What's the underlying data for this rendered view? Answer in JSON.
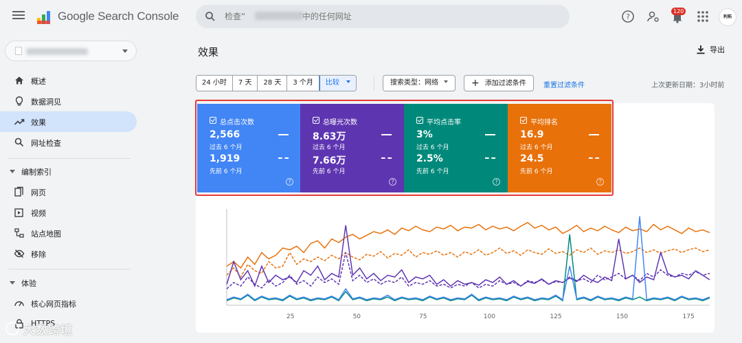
{
  "app": {
    "title": "Google Search Console",
    "notification_count": "120",
    "avatar_text": "利拓"
  },
  "search": {
    "placeholder": "检查“                    ”中的任何网址"
  },
  "sidebar": {
    "items": [
      {
        "label": "概述",
        "icon": "home-icon"
      },
      {
        "label": "数据洞见",
        "icon": "lightbulb-icon"
      },
      {
        "label": "效果",
        "icon": "trending-up-icon",
        "active": true
      },
      {
        "label": "网址检查",
        "icon": "search-icon"
      }
    ],
    "sections": [
      {
        "label": "编制索引",
        "items": [
          {
            "label": "网页",
            "icon": "pages-icon"
          },
          {
            "label": "视频",
            "icon": "video-icon"
          },
          {
            "label": "站点地图",
            "icon": "sitemap-icon"
          },
          {
            "label": "移除",
            "icon": "eye-off-icon"
          }
        ]
      },
      {
        "label": "体验",
        "items": [
          {
            "label": "核心网页指标",
            "icon": "speed-icon"
          },
          {
            "label": "HTTPS",
            "icon": "lock-icon"
          }
        ]
      }
    ]
  },
  "main": {
    "title": "效果",
    "export_label": "导出",
    "date_ranges": [
      "24 小时",
      "7 天",
      "28 天",
      "3 个月",
      "比较"
    ],
    "search_type_label": "搜索类型：网络",
    "add_filter_label": "添加过滤条件",
    "reset_filters_label": "重置过滤条件",
    "last_update": "上次更新日期：3小时前"
  },
  "metrics": [
    {
      "title": "总点击次数",
      "current": "2,566",
      "current_period": "过去 6 个月",
      "previous": "1,919",
      "previous_period": "先前 6 个月",
      "color": "#4285f4"
    },
    {
      "title": "总曝光次数",
      "current": "8.63万",
      "current_period": "过去 6 个月",
      "previous": "7.66万",
      "previous_period": "先前 6 个月",
      "color": "#5e35b1"
    },
    {
      "title": "平均点击率",
      "current": "3%",
      "current_period": "过去 6 个月",
      "previous": "2.5%",
      "previous_period": "先前 6 个月",
      "color": "#00897b"
    },
    {
      "title": "平均排名",
      "current": "16.9",
      "current_period": "过去 6 个月",
      "previous": "24.5",
      "previous_period": "先前 6 个月",
      "color": "#e8710a"
    }
  ],
  "chart_data": {
    "type": "line",
    "x_ticks": [
      "25",
      "50",
      "75",
      "100",
      "125",
      "150",
      "175"
    ],
    "xlim": [
      1,
      183
    ],
    "ylim": [
      0,
      1
    ],
    "grid": false,
    "series": [
      {
        "color": "#e8710a",
        "style": "solid",
        "values": [
          0.4,
          0.45,
          0.38,
          0.5,
          0.42,
          0.55,
          0.48,
          0.52,
          0.6,
          0.58,
          0.62,
          0.55,
          0.65,
          0.68,
          0.6,
          0.7,
          0.66,
          0.72,
          0.75,
          0.7,
          0.74,
          0.78,
          0.76,
          0.8,
          0.75,
          0.82,
          0.79,
          0.84,
          0.8,
          0.78,
          0.83,
          0.81,
          0.85,
          0.79,
          0.83,
          0.82,
          0.86,
          0.8,
          0.84,
          0.81,
          0.83,
          0.79,
          0.84,
          0.88,
          0.82,
          0.85,
          0.8,
          0.83,
          0.76,
          0.8,
          0.85,
          0.78,
          0.82,
          0.79,
          0.84,
          0.8,
          0.77,
          0.83,
          0.79,
          0.81,
          0.78,
          0.86,
          0.8,
          0.84,
          0.8,
          0.76,
          0.82,
          0.78,
          0.8,
          0.77
        ]
      },
      {
        "color": "#e8710a",
        "style": "dashed",
        "values": [
          0.3,
          0.38,
          0.28,
          0.42,
          0.35,
          0.32,
          0.45,
          0.38,
          0.4,
          0.55,
          0.42,
          0.48,
          0.45,
          0.5,
          0.46,
          0.52,
          0.48,
          0.55,
          0.5,
          0.47,
          0.53,
          0.51,
          0.56,
          0.49,
          0.54,
          0.52,
          0.58,
          0.5,
          0.55,
          0.53,
          0.57,
          0.52,
          0.55,
          0.5,
          0.56,
          0.53,
          0.58,
          0.52,
          0.55,
          0.6,
          0.54,
          0.57,
          0.52,
          0.58,
          0.55,
          0.53,
          0.59,
          0.54,
          0.56,
          0.52,
          0.58,
          0.55,
          0.6,
          0.53,
          0.57,
          0.55,
          0.58,
          0.54,
          0.56,
          0.6,
          0.55,
          0.58,
          0.54,
          0.57,
          0.59,
          0.55,
          0.58,
          0.6,
          0.56,
          0.58
        ]
      },
      {
        "color": "#5e35b1",
        "style": "solid",
        "values": [
          0.2,
          0.45,
          0.25,
          0.35,
          0.18,
          0.4,
          0.22,
          0.3,
          0.25,
          0.28,
          0.22,
          0.35,
          0.3,
          0.4,
          0.25,
          0.32,
          0.28,
          0.85,
          0.3,
          0.38,
          0.26,
          0.32,
          0.24,
          0.3,
          0.28,
          0.36,
          0.22,
          0.28,
          0.26,
          0.3,
          0.2,
          0.25,
          0.18,
          0.24,
          0.2,
          0.22,
          0.19,
          0.25,
          0.22,
          0.28,
          0.2,
          0.24,
          0.18,
          0.23,
          0.21,
          0.26,
          0.2,
          0.24,
          0.22,
          0.27,
          0.23,
          0.3,
          0.25,
          0.22,
          0.28,
          0.24,
          0.7,
          0.26,
          0.3,
          0.22,
          0.28,
          0.25,
          0.55,
          0.32,
          0.28,
          0.3,
          0.26,
          0.35,
          0.3,
          0.25
        ]
      },
      {
        "color": "#5e35b1",
        "style": "dashed",
        "values": [
          0.15,
          0.22,
          0.18,
          0.28,
          0.2,
          0.16,
          0.25,
          0.18,
          0.22,
          0.3,
          0.2,
          0.24,
          0.18,
          0.28,
          0.22,
          0.26,
          0.2,
          0.55,
          0.24,
          0.3,
          0.22,
          0.26,
          0.2,
          0.24,
          0.22,
          0.28,
          0.18,
          0.22,
          0.2,
          0.24,
          0.18,
          0.2,
          0.16,
          0.2,
          0.18,
          0.22,
          0.16,
          0.2,
          0.18,
          0.24,
          0.2,
          0.22,
          0.18,
          0.24,
          0.22,
          0.25,
          0.2,
          0.23,
          0.22,
          0.28,
          0.24,
          0.26,
          0.22,
          0.3,
          0.25,
          0.28,
          0.32,
          0.26,
          0.3,
          0.24,
          0.32,
          0.28,
          0.36,
          0.3,
          0.28,
          0.32,
          0.3,
          0.34,
          0.3,
          0.32
        ]
      },
      {
        "color": "#00897b",
        "style": "solid",
        "values": [
          0.02,
          0.05,
          0.03,
          0.08,
          0.02,
          0.06,
          0.03,
          0.04,
          0.02,
          0.07,
          0.03,
          0.05,
          0.02,
          0.04,
          0.03,
          0.06,
          0.02,
          0.12,
          0.03,
          0.05,
          0.02,
          0.04,
          0.03,
          0.06,
          0.02,
          0.05,
          0.03,
          0.04,
          0.02,
          0.06,
          0.03,
          0.05,
          0.02,
          0.04,
          0.03,
          0.08,
          0.02,
          0.05,
          0.03,
          0.04,
          0.02,
          0.06,
          0.03,
          0.05,
          0.02,
          0.04,
          0.03,
          0.07,
          0.02,
          0.75,
          0.03,
          0.05,
          0.02,
          0.06,
          0.03,
          0.04,
          0.02,
          0.05,
          0.03,
          0.06,
          0.02,
          0.04,
          0.03,
          0.05,
          0.02,
          0.06,
          0.03,
          0.04,
          0.02,
          0.05
        ]
      },
      {
        "color": "#4285f4",
        "style": "solid",
        "values": [
          0.03,
          0.06,
          0.04,
          0.09,
          0.03,
          0.07,
          0.04,
          0.05,
          0.03,
          0.08,
          0.04,
          0.06,
          0.03,
          0.05,
          0.04,
          0.07,
          0.03,
          0.15,
          0.04,
          0.06,
          0.03,
          0.05,
          0.04,
          0.08,
          0.03,
          0.06,
          0.04,
          0.05,
          0.03,
          0.07,
          0.04,
          0.06,
          0.03,
          0.05,
          0.04,
          0.09,
          0.03,
          0.06,
          0.04,
          0.05,
          0.03,
          0.07,
          0.04,
          0.06,
          0.03,
          0.05,
          0.04,
          0.08,
          0.03,
          0.4,
          0.04,
          0.06,
          0.03,
          0.07,
          0.04,
          0.05,
          0.03,
          0.06,
          0.04,
          0.95,
          0.03,
          0.05,
          0.04,
          0.06,
          0.03,
          0.07,
          0.04,
          0.05,
          0.03,
          0.06
        ]
      }
    ]
  },
  "watermark": "大数跨境"
}
